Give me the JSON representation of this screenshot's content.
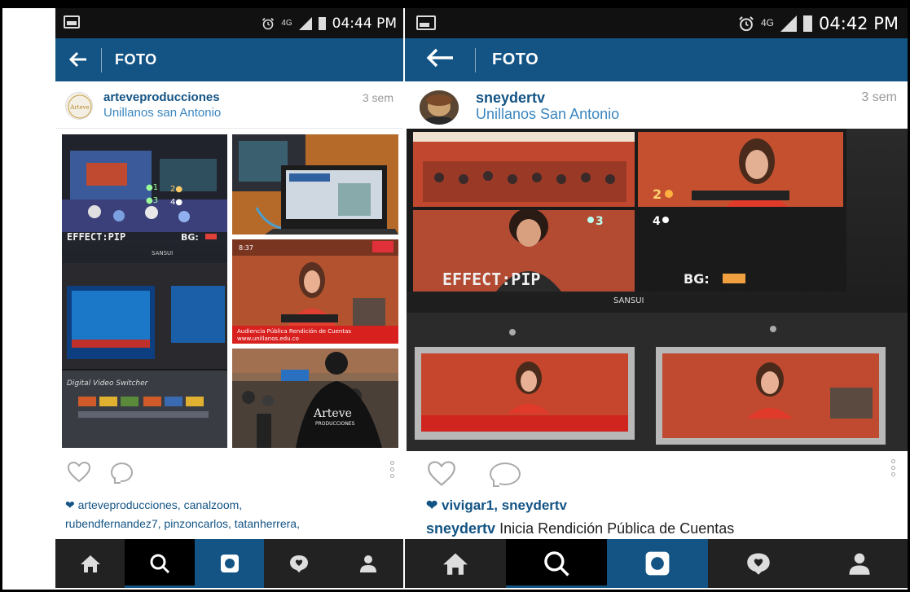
{
  "screens": [
    {
      "status": {
        "network": "4G",
        "time": "04:44 PM"
      },
      "appbar": {
        "title": "FOTO"
      },
      "post": {
        "username": "arteveproducciones",
        "location": "Unillanos san Antonio",
        "ago": "3 sem",
        "avatar_text": "Arteve",
        "collage": {
          "effect_label": "EFFECT:PIP",
          "bg_label": "BG:",
          "switcher_label": "Digital Video Switcher",
          "brand_label": "SANSUI",
          "banner_text": "Audiencia Pública Rendición de Cuentas",
          "banner_url": "www.unillanos.edu.co",
          "tv_time": "8:37",
          "shirt_text": "Arteve",
          "shirt_sub": "PRODUCCIONES"
        },
        "likes_line1": "arteveproducciones, canalzoom,",
        "likes_line2": "rubendfernandez7, pinzoncarlos, tatanherrera,"
      }
    },
    {
      "status": {
        "network": "4G",
        "time": "04:42 PM"
      },
      "appbar": {
        "title": "FOTO"
      },
      "post": {
        "username": "sneydertv",
        "location": "Unillanos San Antonio",
        "ago": "3 sem",
        "photo": {
          "effect_label": "EFFECT:PIP",
          "bg_label": "BG:",
          "brand_label": "SANSUI",
          "quad_labels": [
            "2",
            "3",
            "4"
          ]
        },
        "likes": "vivigar1, sneydertv",
        "caption_user": "sneydertv",
        "caption_text": "Inicia Rendición Pública de Cuentas"
      }
    }
  ],
  "colors": {
    "brand": "#135485",
    "link": "#3a86c0",
    "statusbar": "#111111",
    "nav": "#222222"
  },
  "nav_icons": [
    "home-icon",
    "search-icon",
    "camera-icon",
    "news-icon",
    "profile-icon"
  ]
}
